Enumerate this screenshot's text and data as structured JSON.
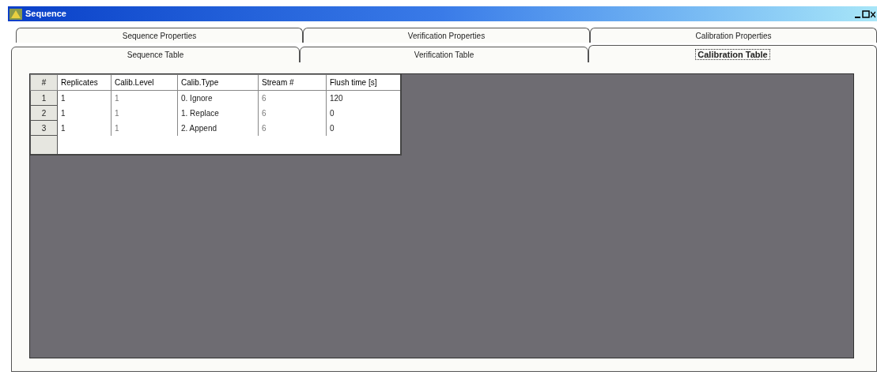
{
  "window": {
    "title": "Sequence"
  },
  "tab_rows": [
    [
      {
        "label": "Sequence Properties",
        "selected": false
      },
      {
        "label": "Verification Properties",
        "selected": false
      },
      {
        "label": "Calibration Properties",
        "selected": false
      }
    ],
    [
      {
        "label": "Sequence Table",
        "selected": false
      },
      {
        "label": "Verification Table",
        "selected": false
      },
      {
        "label": "Calibration Table",
        "selected": true
      }
    ]
  ],
  "table": {
    "columns": [
      "#",
      "Replicates",
      "Calib.Level",
      "Calib.Type",
      "Stream #",
      "Flush time [s]"
    ],
    "rows": [
      [
        "1",
        "1",
        "1",
        "0. Ignore",
        "6",
        "120"
      ],
      [
        "2",
        "1",
        "1",
        "1. Replace",
        "6",
        "0"
      ],
      [
        "3",
        "1",
        "1",
        "2. Append",
        "6",
        "0"
      ]
    ]
  }
}
